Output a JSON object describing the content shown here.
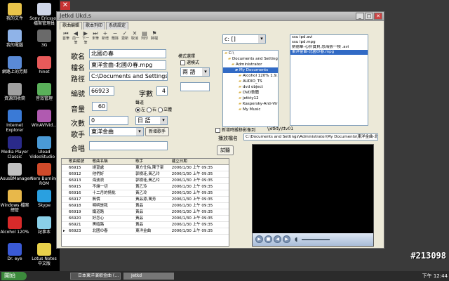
{
  "desktop": {
    "icons": [
      {
        "label": "我的文件",
        "color": "#e8c34a"
      },
      {
        "label": "Sony Ericsson 檔案管理員",
        "color": "#cfd6e8"
      },
      {
        "label": "我的電腦",
        "color": "#8fb3e8"
      },
      {
        "label": "3G",
        "color": "#6a6a6a"
      },
      {
        "label": "網路上的芳鄰",
        "color": "#5a8ad6"
      },
      {
        "label": "hinet",
        "color": "#e85a5a"
      },
      {
        "label": "資源回收筒",
        "color": "#a0a0a0"
      },
      {
        "label": "音效管理",
        "color": "#5ab05a"
      },
      {
        "label": "Internet Explorer",
        "color": "#3a7ad6"
      },
      {
        "label": "WinAVIVid…",
        "color": "#b05ab0"
      },
      {
        "label": "Media Player Classic",
        "color": "#2a2a8a"
      },
      {
        "label": "Ulead VideoStudio 8",
        "color": "#4a9ad6"
      },
      {
        "label": "AsusBManager",
        "color": "#c0c0c0"
      },
      {
        "label": "Nero Burning ROM",
        "color": "#d04a2a"
      },
      {
        "label": "Windows 檔案總管",
        "color": "#e8b84a"
      },
      {
        "label": "Skype",
        "color": "#2aa0e0"
      },
      {
        "label": "Alcohol 120%",
        "color": "#d82a2a"
      },
      {
        "label": "記事本",
        "color": "#8ad0e8"
      },
      {
        "label": "Dr. eye",
        "color": "#3a5ad6"
      },
      {
        "label": "Lotus Notes 中文版",
        "color": "#e8d04a"
      }
    ],
    "recycle_icon_name": "x-icon"
  },
  "window": {
    "title": "Jetkd Ukd.s",
    "tabs": [
      "歌曲編輯",
      "歌本列印",
      "系統設定"
    ],
    "active_tab": 0,
    "toolbar": [
      {
        "label": "首筆",
        "icon": "⏮"
      },
      {
        "label": "前一筆",
        "icon": "◀"
      },
      {
        "label": "下一筆",
        "icon": "▶"
      },
      {
        "label": "末筆",
        "icon": "⏭"
      },
      {
        "label": "新增",
        "icon": "+"
      },
      {
        "label": "刪除",
        "icon": "−"
      },
      {
        "label": "更新",
        "icon": "✓"
      },
      {
        "label": "取消",
        "icon": "✕"
      },
      {
        "label": "列印",
        "icon": "▤"
      },
      {
        "label": "歸檔",
        "icon": "⚑"
      }
    ],
    "form": {
      "song_name_label": "歌名",
      "song_name_value": "北國の春",
      "file_name_label": "檔名",
      "file_name_value": "東洋金曲-北國の春.mpg",
      "path_label": "路徑",
      "path_value": "C:\\Documents and Settings\\Ad",
      "number_label": "編號",
      "number_value": "66923",
      "word_count_label": "字數",
      "word_count_value": "4",
      "volume_label": "音量",
      "volume_value": "60",
      "channel_label": "聲道",
      "channel_options": [
        "左",
        "右",
        "立體"
      ],
      "channel_selected": 0,
      "count_label": "次數",
      "count_value": "0",
      "language_value": "日 語",
      "singer_label": "歌手",
      "singer_value": "東洋金曲",
      "new_singer_button": "新增歌手",
      "chorus_label": "合唱",
      "chorus_value": ""
    },
    "mode": {
      "group_label": "模式選擇",
      "checkbox_label": "選模式",
      "select_value": "兩 語"
    },
    "drive_select": "c: []",
    "tree": [
      {
        "label": "C:\\",
        "indent": 0,
        "selected": false
      },
      {
        "label": "Documents and Settings",
        "indent": 1,
        "selected": false
      },
      {
        "label": "Administrator",
        "indent": 2,
        "selected": false
      },
      {
        "label": "My Documents",
        "indent": 3,
        "selected": true
      },
      {
        "label": "Alcohol 120% 1.9.5.2722",
        "indent": 4,
        "selected": false
      },
      {
        "label": "AUDIO_TS",
        "indent": 4,
        "selected": false
      },
      {
        "label": "dvd object",
        "indent": 4,
        "selected": false
      },
      {
        "label": "DVD軟體",
        "indent": 4,
        "selected": false
      },
      {
        "label": "jetkty12",
        "indent": 4,
        "selected": false
      },
      {
        "label": "Kaspersky-Anti-Virus Perso",
        "indent": 4,
        "selected": false
      },
      {
        "label": "My Music",
        "indent": 4,
        "selected": false
      }
    ],
    "files": [
      {
        "label": "ssu ipd.avi",
        "selected": false
      },
      {
        "label": "ssu ipd.mpg",
        "selected": false
      },
      {
        "label": "劉德華-心肝寶貝,怒海張一槓 .avi",
        "selected": false
      },
      {
        "label": "東洋金曲-北國の春.mpg",
        "selected": true
      }
    ],
    "auto_add_label": "新增時搬移影像到",
    "auto_add_path": "\\jetkty\\ttv01",
    "play_file_label": "播放檔名",
    "play_file_value": "C:\\Documents and Settings\\Administrator\\My Documents\\東洋金曲-北國の春",
    "test_button": "試聽",
    "table": {
      "headers": [
        "",
        "歌曲編號",
        "歌曲名稱",
        "歌手",
        "建立日期"
      ],
      "rows": [
        [
          "",
          "66915",
          "絕望處",
          "東方仕佑,陳子豪",
          "2006/1/30 上午 09:35"
        ],
        [
          "",
          "66912",
          "他們好",
          "郭樹珪,黃乙玲",
          "2006/1/30 上午 09:35"
        ],
        [
          "",
          "66913",
          "海波浪",
          "郭樹珪,黃乙玲",
          "2006/1/30 上午 09:35"
        ],
        [
          "",
          "66915",
          "不讓一切",
          "黃乙玲",
          "2006/1/30 上午 09:35"
        ],
        [
          "",
          "66916",
          "十二月的情批",
          "黃乙玲",
          "2006/1/30 上午 09:35"
        ],
        [
          "",
          "66917",
          "無價",
          "黃品源,萬芳",
          "2006/1/30 上午 09:35"
        ],
        [
          "",
          "66918",
          "明明是我",
          "黃品",
          "2006/1/30 上午 09:35"
        ],
        [
          "",
          "66919",
          "鐵道路",
          "黃品",
          "2006/1/30 上午 09:35"
        ],
        [
          "",
          "66920",
          "好怎心",
          "黃品",
          "2006/1/30 上午 09:35"
        ],
        [
          "",
          "66921",
          "黑暗路",
          "黃品",
          "2006/1/30 上午 09:35"
        ],
        [
          "▸",
          "66923",
          "北國の春",
          "東洋金曲",
          "2006/1/30 上午 09:35"
        ]
      ]
    }
  },
  "taskbar": {
    "start_label": "開始",
    "tasks": [
      {
        "label": "日本東洋演歌金曲 (…",
        "active": false
      },
      {
        "label": "Jetkd",
        "active": true
      }
    ],
    "clock": "下午 12:44"
  },
  "watermark": "#213098"
}
